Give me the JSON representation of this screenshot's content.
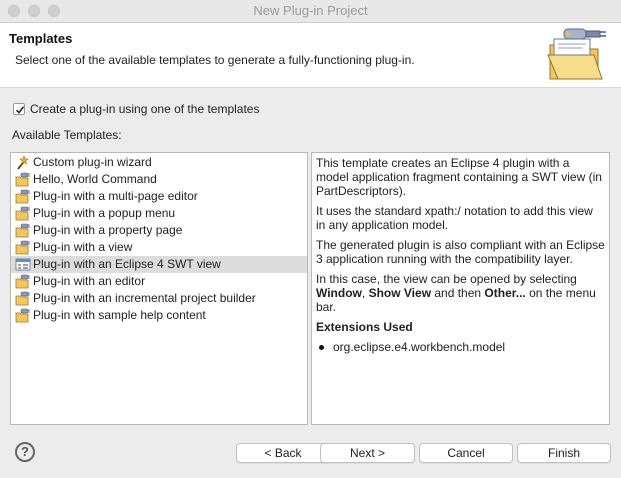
{
  "window": {
    "title": "New Plug-in Project"
  },
  "header": {
    "title": "Templates",
    "description": "Select one of the available templates to generate a fully-functioning plug-in.",
    "banner_icon": "plugin-folder-icon"
  },
  "checkbox": {
    "label": "Create a plug-in using one of the templates",
    "checked": true
  },
  "templates": {
    "label": "Available Templates:",
    "items": [
      {
        "label": "Custom plug-in wizard",
        "icon": "wizard-icon"
      },
      {
        "label": "Hello, World Command",
        "icon": "plugin-template-icon"
      },
      {
        "label": "Plug-in with a multi-page editor",
        "icon": "plugin-template-icon"
      },
      {
        "label": "Plug-in with a popup menu",
        "icon": "plugin-template-icon"
      },
      {
        "label": "Plug-in with a property page",
        "icon": "plugin-template-icon"
      },
      {
        "label": "Plug-in with a view",
        "icon": "plugin-template-icon"
      },
      {
        "label": "Plug-in with an Eclipse 4 SWT view",
        "icon": "e4-view-icon",
        "selected": true
      },
      {
        "label": "Plug-in with an editor",
        "icon": "plugin-template-icon"
      },
      {
        "label": "Plug-in with an incremental project builder",
        "icon": "plugin-template-icon"
      },
      {
        "label": "Plug-in with sample help content",
        "icon": "plugin-template-icon"
      }
    ]
  },
  "description": {
    "p1": "This template creates an Eclipse 4 plugin with a model application fragment containing a SWT view (in PartDescriptors).",
    "p2": "It uses the standard xpath:/ notation to add this view in any application model.",
    "p3": "The generated plugin is also compliant with an Eclipse 3 application running with the compatibility layer.",
    "p4_pre": "In this case, the view can be opened by selecting ",
    "p4_b1": "Window",
    "p4_sep1": ", ",
    "p4_b2": "Show View",
    "p4_mid": " and then ",
    "p4_b3": "Other...",
    "p4_post": " on the menu bar.",
    "ext_heading": "Extensions Used",
    "ext_item": "org.eclipse.e4.workbench.model"
  },
  "buttons": {
    "help_icon": "help-icon",
    "help_glyph": "?",
    "back": "< Back",
    "next": "Next >",
    "cancel": "Cancel",
    "finish": "Finish"
  }
}
